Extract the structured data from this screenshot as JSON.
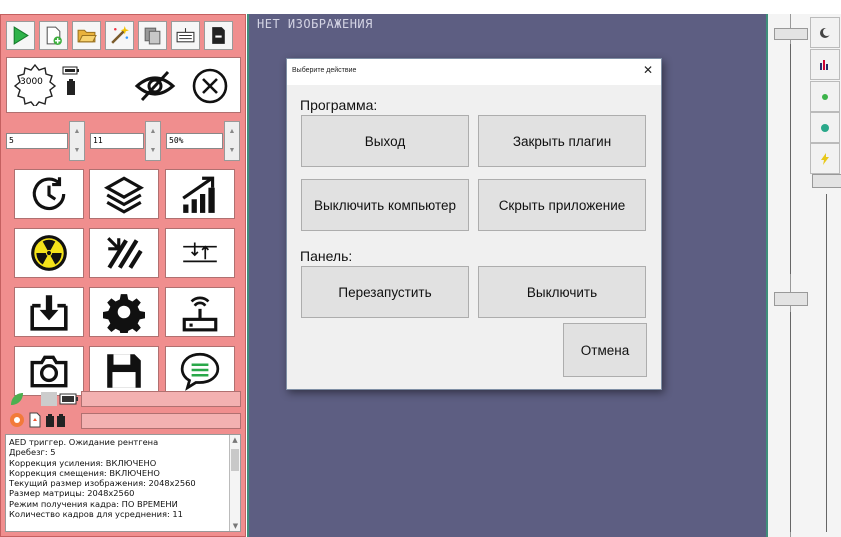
{
  "toolbar": {
    "icons": [
      "play-icon",
      "new-document-icon",
      "open-folder-icon",
      "magic-wand-icon",
      "copy-icon",
      "keyboard-icon",
      "save-file-icon"
    ]
  },
  "top_controls": {
    "gear_counter": "3000",
    "eye_icon": "eye-slash-icon",
    "close_icon": "circle-x-icon"
  },
  "spinners": [
    {
      "value": "5"
    },
    {
      "value": "11"
    },
    {
      "value": "50%"
    }
  ],
  "tiles": [
    "clock-refresh-icon",
    "layers-icon",
    "growth-chart-icon",
    "radiation-icon",
    "diagonal-scan-icon",
    "vertical-align-icon",
    "download-icon",
    "gear-icon",
    "wireless-device-icon",
    "camera-icon",
    "floppy-save-icon",
    "chat-bubble-icon"
  ],
  "viewer": {
    "status_text": "НЕТ ИЗОБРАЖЕНИЯ"
  },
  "log": {
    "lines": [
      "AED триггер. Ожидание рентгена",
      "Дребезг: 5",
      "Коррекция усиления: ВКЛЮЧЕНО",
      "Коррекция смещения: ВКЛЮЧЕНО",
      "Текущий размер изображения: 2048x2560",
      "Размер матрицы: 2048x2560",
      "Режим получения кадра: ПО ВРЕМЕНИ",
      "Количество кадров для усреднения: 11"
    ]
  },
  "dialog": {
    "title": "Выберите действие",
    "close_symbol": "✕",
    "program_label": "Программа:",
    "panel_label": "Панель:",
    "buttons": {
      "exit": "Выход",
      "close_plugin": "Закрыть плагин",
      "shutdown_pc": "Выключить компьютер",
      "hide_app": "Скрыть приложение",
      "restart": "Перезапустить",
      "turn_off": "Выключить",
      "cancel": "Отмена"
    }
  },
  "colors": {
    "left_panel": "#f08e8e",
    "viewer_bg": "#5d5e82",
    "accent_green": "#3f8e7b",
    "dialog_bg": "#f0f0f0"
  }
}
